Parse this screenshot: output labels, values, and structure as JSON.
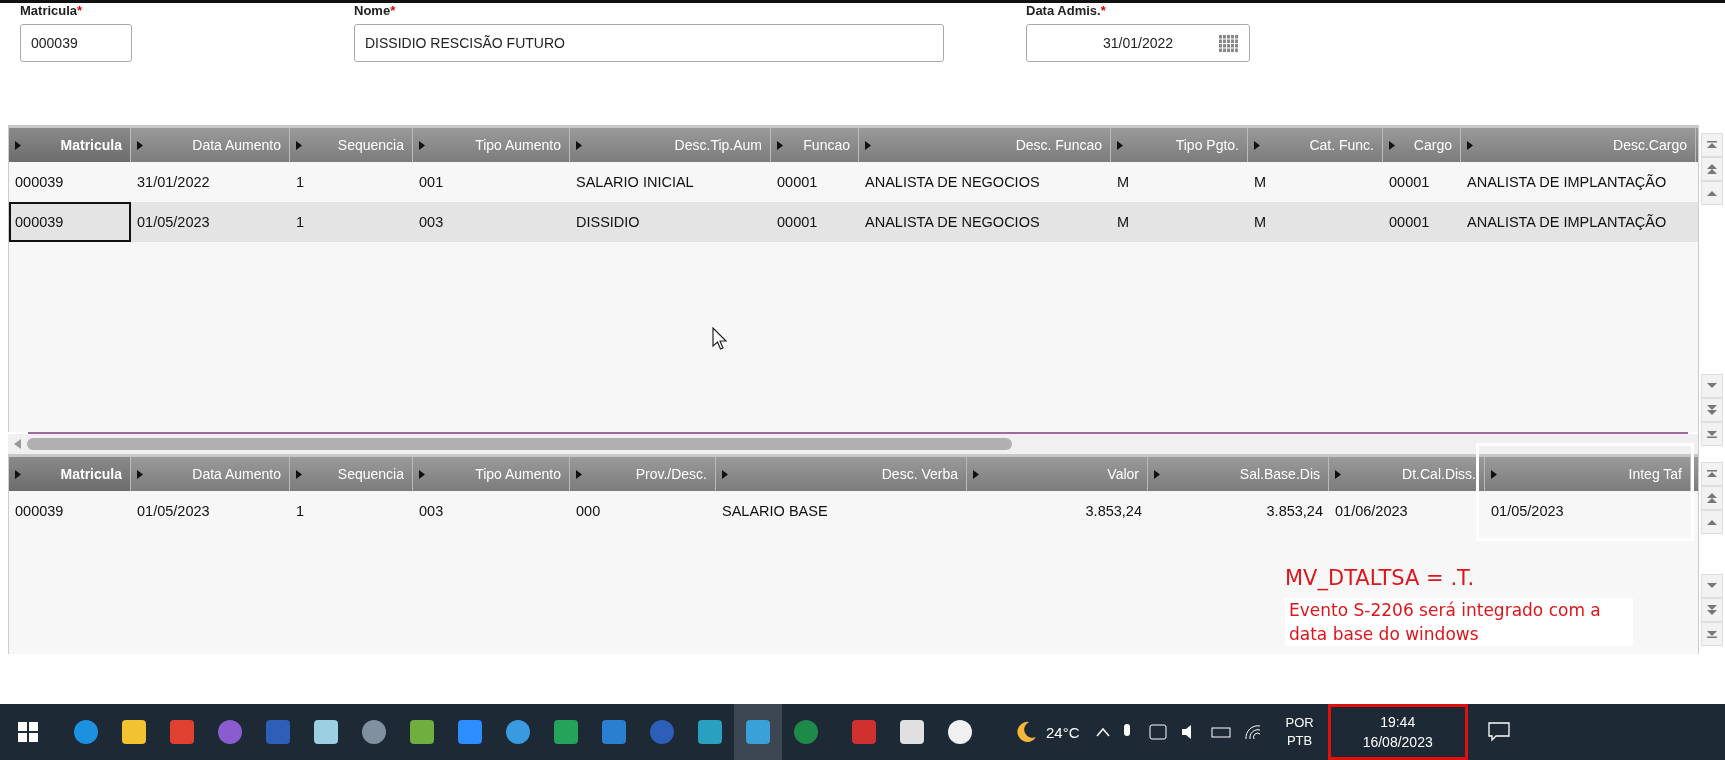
{
  "form": {
    "fields": [
      {
        "label": "Matricula",
        "mark": "*",
        "value": "000039",
        "kind": "text"
      },
      {
        "label": "Nome",
        "mark": "*",
        "value": "DISSIDIO RESCISÃO FUTURO",
        "kind": "text"
      },
      {
        "label": "Data Admis.",
        "mark": "*",
        "value": "31/01/2022",
        "kind": "date"
      }
    ]
  },
  "grid_top": {
    "columns": [
      {
        "label": "Matricula",
        "selected": true
      },
      {
        "label": "Data Aumento",
        "selected": false
      },
      {
        "label": "Sequencia",
        "selected": false
      },
      {
        "label": "Tipo Aumento",
        "selected": false
      },
      {
        "label": "Desc.Tip.Aum",
        "selected": false
      },
      {
        "label": "Funcao",
        "selected": false
      },
      {
        "label": "Desc. Funcao",
        "selected": false
      },
      {
        "label": "Tipo Pgto.",
        "selected": false
      },
      {
        "label": "Cat. Func.",
        "selected": false
      },
      {
        "label": "Cargo",
        "selected": false
      },
      {
        "label": "Desc.Cargo",
        "selected": false
      }
    ],
    "rows": [
      {
        "selected": false,
        "cells": [
          "000039",
          "31/01/2022",
          "1",
          "001",
          "SALARIO INICIAL",
          "00001",
          "ANALISTA DE NEGOCIOS",
          "M",
          "M",
          "00001",
          "ANALISTA DE IMPLANTAÇÃO"
        ]
      },
      {
        "selected": true,
        "cells": [
          "000039",
          "01/05/2023",
          "1",
          "003",
          "DISSIDIO",
          "00001",
          "ANALISTA DE NEGOCIOS",
          "M",
          "M",
          "00001",
          "ANALISTA DE IMPLANTAÇÃO"
        ]
      }
    ]
  },
  "grid_bottom": {
    "columns": [
      {
        "label": "Matricula",
        "selected": true
      },
      {
        "label": "Data Aumento",
        "selected": false
      },
      {
        "label": "Sequencia",
        "selected": false
      },
      {
        "label": "Tipo Aumento",
        "selected": false
      },
      {
        "label": "Prov./Desc.",
        "selected": false
      },
      {
        "label": "Desc. Verba",
        "selected": false
      },
      {
        "label": "Valor",
        "selected": false
      },
      {
        "label": "Sal.Base.Dis",
        "selected": false
      },
      {
        "label": "Dt.Cal.Diss.",
        "selected": false
      },
      {
        "label": "Integ Taf",
        "selected": false
      }
    ],
    "rows": [
      {
        "selected": false,
        "cells": [
          "000039",
          "01/05/2023",
          "1",
          "003",
          "000",
          "SALARIO BASE",
          "3.853,24",
          "3.853,24",
          "01/06/2023",
          "01/05/2023"
        ]
      }
    ]
  },
  "annotation": {
    "title": "MV_DTALTSA = .T.",
    "note": "Evento S-2206 será integrado com a data base do windows"
  },
  "taskbar": {
    "apps": [
      {
        "active": false
      },
      {
        "active": false
      },
      {
        "active": false
      },
      {
        "active": false
      },
      {
        "active": false
      },
      {
        "active": false
      },
      {
        "active": false
      },
      {
        "active": false
      },
      {
        "active": false
      },
      {
        "active": false
      },
      {
        "active": false
      },
      {
        "active": false
      },
      {
        "active": false
      },
      {
        "active": false
      },
      {
        "active": true
      },
      {
        "active": false
      },
      {
        "active": false
      },
      {
        "active": false
      },
      {
        "active": false
      }
    ],
    "weather": "24°C",
    "language": [
      "POR",
      "PTB"
    ],
    "time": "19:44",
    "date": "16/08/2023"
  }
}
